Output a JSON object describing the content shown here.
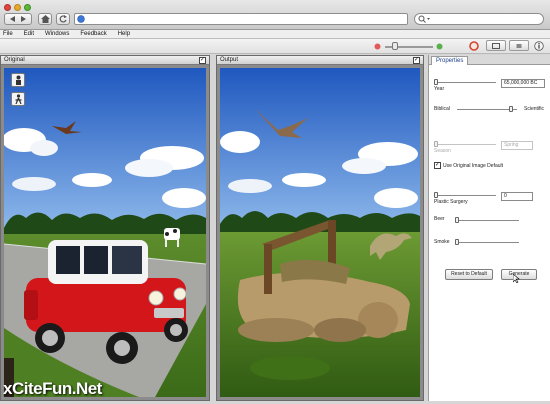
{
  "menu": {
    "items": [
      {
        "label": "File"
      },
      {
        "label": "Edit"
      },
      {
        "label": "Windows"
      },
      {
        "label": "Feedback"
      },
      {
        "label": "Help"
      }
    ]
  },
  "panels": {
    "original": {
      "title": "Original"
    },
    "output": {
      "title": "Output"
    }
  },
  "properties": {
    "tab_label": "Properties",
    "year_label": "Year",
    "year_value": "65,000,000 BC",
    "biblical_label": "Biblical",
    "scientific_label": "Scientific",
    "season_label": "Season",
    "season_value": "Spring",
    "use_original_label": "Use Original Image Default",
    "plastic_label": "Plastic Surgery",
    "plastic_value": "0",
    "beer_label": "Beer",
    "smoke_label": "Smoke",
    "reset_label": "Reset to Default",
    "generate_label": "Generate"
  },
  "watermark": "xCiteFun.Net",
  "colors": {
    "sky": "#2f6fd0",
    "grass": "#5f8f2e",
    "car_red": "#d2161a",
    "accent_blue": "#1d3f8a"
  }
}
